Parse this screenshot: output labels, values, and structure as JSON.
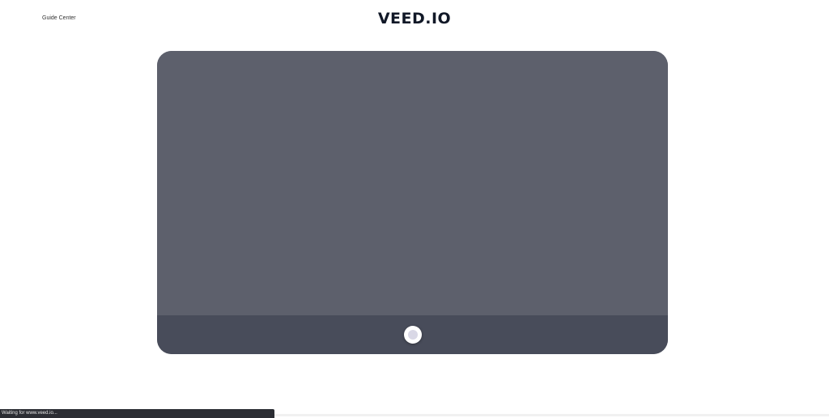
{
  "header": {
    "guide_link": "Guide Center",
    "logo": "VEED.IO"
  },
  "recorder": {
    "record_button_icon": "record-icon",
    "colors": {
      "preview": "#5d606c",
      "control_bar": "#484c5a",
      "button": "#ffffff",
      "button_dot": "#d9d8e6"
    }
  },
  "browser_status": {
    "text": "Waiting for www.veed.io..."
  }
}
